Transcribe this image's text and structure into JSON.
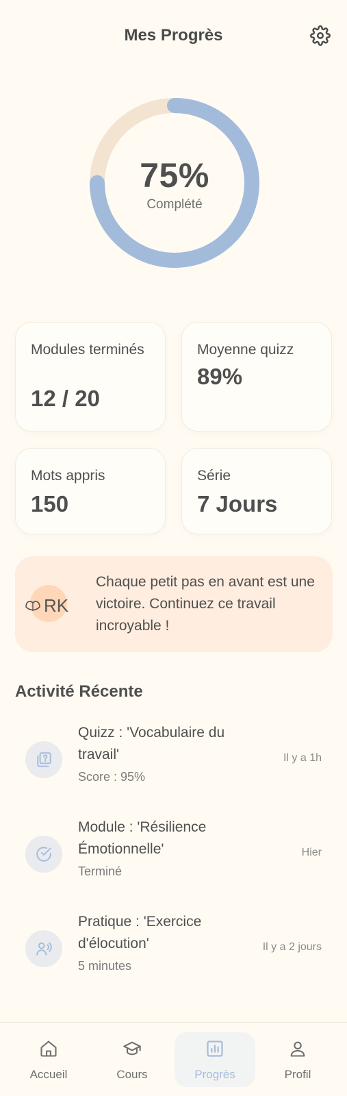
{
  "header": {
    "title": "Mes Progrès",
    "settings_icon": "gear-icon"
  },
  "progress": {
    "percent_label": "75%",
    "value": 0.75,
    "caption": "Complété",
    "track_color": "#f3e4d2",
    "fill_color": "#a3bbdb"
  },
  "stats": [
    {
      "label": "Modules terminés",
      "value": "12 / 20"
    },
    {
      "label": "Moyenne quizz",
      "value": "89%"
    },
    {
      "label": "Mots appris",
      "value": "150"
    },
    {
      "label": "Série",
      "value": "7 Jours"
    }
  ],
  "motivation": {
    "logo_text": "RK",
    "text": "Chaque petit pas en avant est une victoire. Continuez ce travail incroyable !"
  },
  "activity": {
    "section_title": "Activité Récente",
    "items": [
      {
        "icon": "quiz-icon",
        "title": "Quizz : 'Vocabulaire du travail'",
        "subtitle": "Score : 95%",
        "time": "Il y a 1h"
      },
      {
        "icon": "check-circle-icon",
        "title": "Module : 'Résilience Émotionnelle'",
        "subtitle": "Terminé",
        "time": "Hier"
      },
      {
        "icon": "speaking-icon",
        "title": "Pratique : 'Exercice d'élocution'",
        "subtitle": "5 minutes",
        "time": "Il y a 2 jours"
      }
    ]
  },
  "nav": {
    "items": [
      {
        "label": "Accueil",
        "icon": "home-icon"
      },
      {
        "label": "Cours",
        "icon": "graduation-cap-icon"
      },
      {
        "label": "Progrès",
        "icon": "bar-chart-icon",
        "active": true
      },
      {
        "label": "Profil",
        "icon": "user-icon"
      }
    ]
  }
}
